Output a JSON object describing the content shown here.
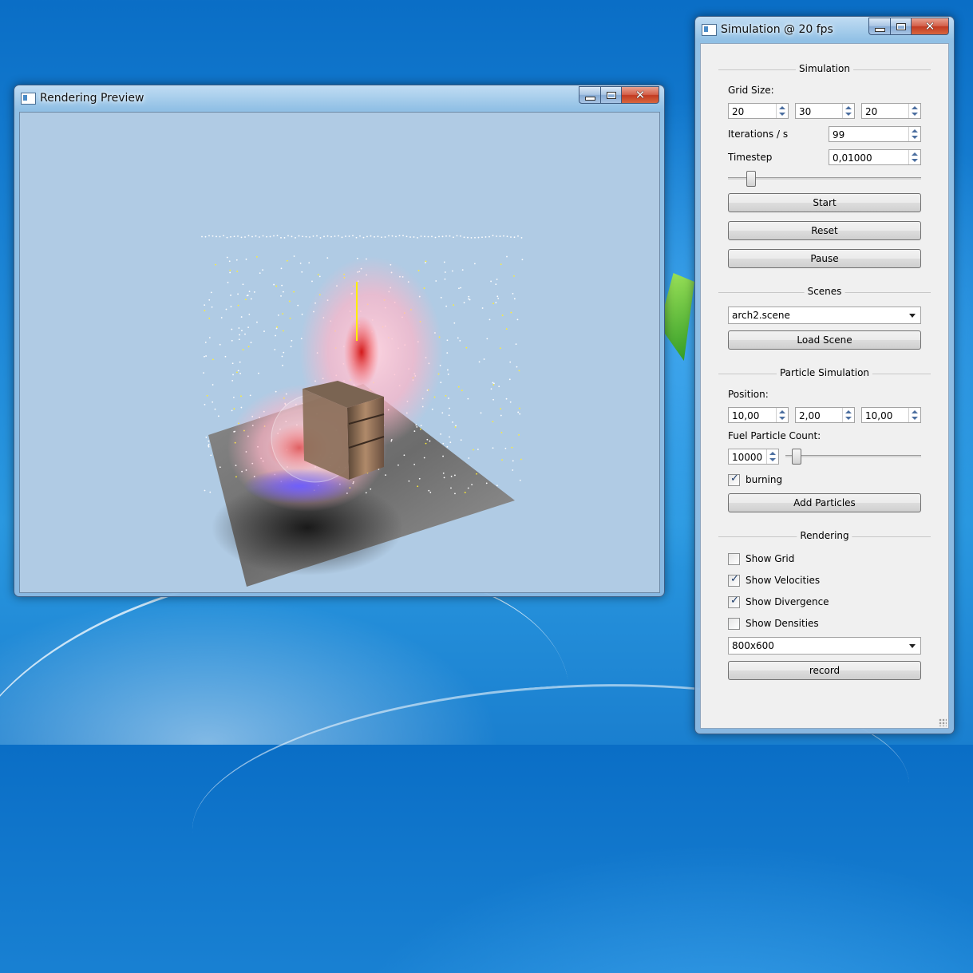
{
  "preview_window": {
    "title": "Rendering Preview"
  },
  "sim_window": {
    "title": "Simulation @ 20 fps"
  },
  "simulation": {
    "group_label": "Simulation",
    "grid_size_label": "Grid Size:",
    "grid_x": "20",
    "grid_y": "30",
    "grid_z": "20",
    "iterations_label": "Iterations / s",
    "iterations_value": "99",
    "timestep_label": "Timestep",
    "timestep_value": "0,01000",
    "timestep_slider_fraction": 0.1,
    "start_label": "Start",
    "reset_label": "Reset",
    "pause_label": "Pause"
  },
  "scenes": {
    "group_label": "Scenes",
    "selected_scene": "arch2.scene",
    "load_label": "Load Scene"
  },
  "particles": {
    "group_label": "Particle Simulation",
    "position_label": "Position:",
    "pos_x": "10,00",
    "pos_y": "2,00",
    "pos_z": "10,00",
    "fuel_label": "Fuel Particle Count:",
    "fuel_value": "10000",
    "fuel_slider_fraction": 0.05,
    "burning_label": "burning",
    "burning_checked": true,
    "add_label": "Add Particles"
  },
  "rendering": {
    "group_label": "Rendering",
    "show_grid_label": "Show Grid",
    "show_grid_checked": false,
    "show_velocities_label": "Show Velocities",
    "show_velocities_checked": true,
    "show_divergence_label": "Show Divergence",
    "show_divergence_checked": true,
    "show_densities_label": "Show Densities",
    "show_densities_checked": false,
    "resolution": "800x600",
    "record_label": "record"
  },
  "icons": {
    "check": "✓",
    "close": "✕"
  },
  "colors": {
    "viewport_bg": "#b0cbe4",
    "flame_pink": "#ffb6c8",
    "flame_red": "#e02020",
    "flame_blue": "#3a3aff",
    "floor_gray": "#6a6a6a"
  }
}
